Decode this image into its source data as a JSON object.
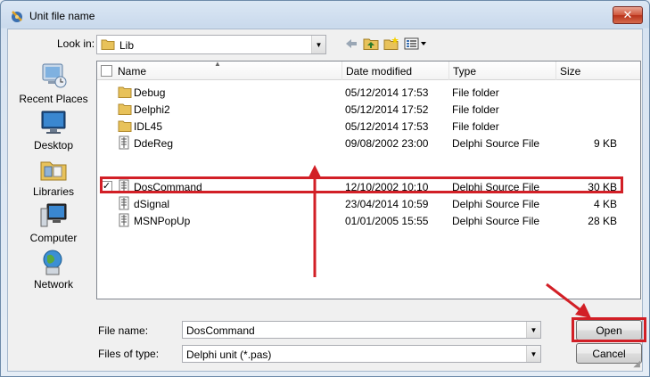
{
  "window": {
    "title": "Unit file name",
    "close_glyph": "✕"
  },
  "toolbar": {
    "look_in_label": "Look in:",
    "look_in_value": "Lib",
    "icons": [
      "back-icon",
      "up-folder-icon",
      "new-folder-icon",
      "view-menu-icon"
    ]
  },
  "places": [
    {
      "label": "Recent Places",
      "icon": "recent-places-icon"
    },
    {
      "label": "Desktop",
      "icon": "desktop-icon"
    },
    {
      "label": "Libraries",
      "icon": "libraries-icon"
    },
    {
      "label": "Computer",
      "icon": "computer-icon"
    },
    {
      "label": "Network",
      "icon": "network-icon"
    }
  ],
  "columns": {
    "name": "Name",
    "date": "Date modified",
    "type": "Type",
    "size": "Size"
  },
  "files": [
    {
      "name": "Debug",
      "date": "05/12/2014 17:53",
      "type": "File folder",
      "size": "",
      "kind": "folder"
    },
    {
      "name": "Delphi2",
      "date": "05/12/2014 17:52",
      "type": "File folder",
      "size": "",
      "kind": "folder"
    },
    {
      "name": "IDL45",
      "date": "05/12/2014 17:53",
      "type": "File folder",
      "size": "",
      "kind": "folder"
    },
    {
      "name": "DdeReg",
      "date": "09/08/2002 23:00",
      "type": "Delphi Source File",
      "size": "9 KB",
      "kind": "pas"
    },
    {
      "name": "DosCommand",
      "date": "12/10/2002 10:10",
      "type": "Delphi Source File",
      "size": "30 KB",
      "kind": "pas",
      "selected": true
    },
    {
      "name": "dSignal",
      "date": "23/04/2014 10:59",
      "type": "Delphi Source File",
      "size": "4 KB",
      "kind": "pas"
    },
    {
      "name": "MSNPopUp",
      "date": "01/01/2005 15:55",
      "type": "Delphi Source File",
      "size": "28 KB",
      "kind": "pas"
    }
  ],
  "file_name": {
    "label": "File name:",
    "value": "DosCommand"
  },
  "file_type": {
    "label": "Files of type:",
    "value": "Delphi unit (*.pas)"
  },
  "buttons": {
    "open": "Open",
    "cancel": "Cancel"
  },
  "colors": {
    "annotation_red": "#d21f26",
    "folder_yellow": "#e8c25a"
  }
}
